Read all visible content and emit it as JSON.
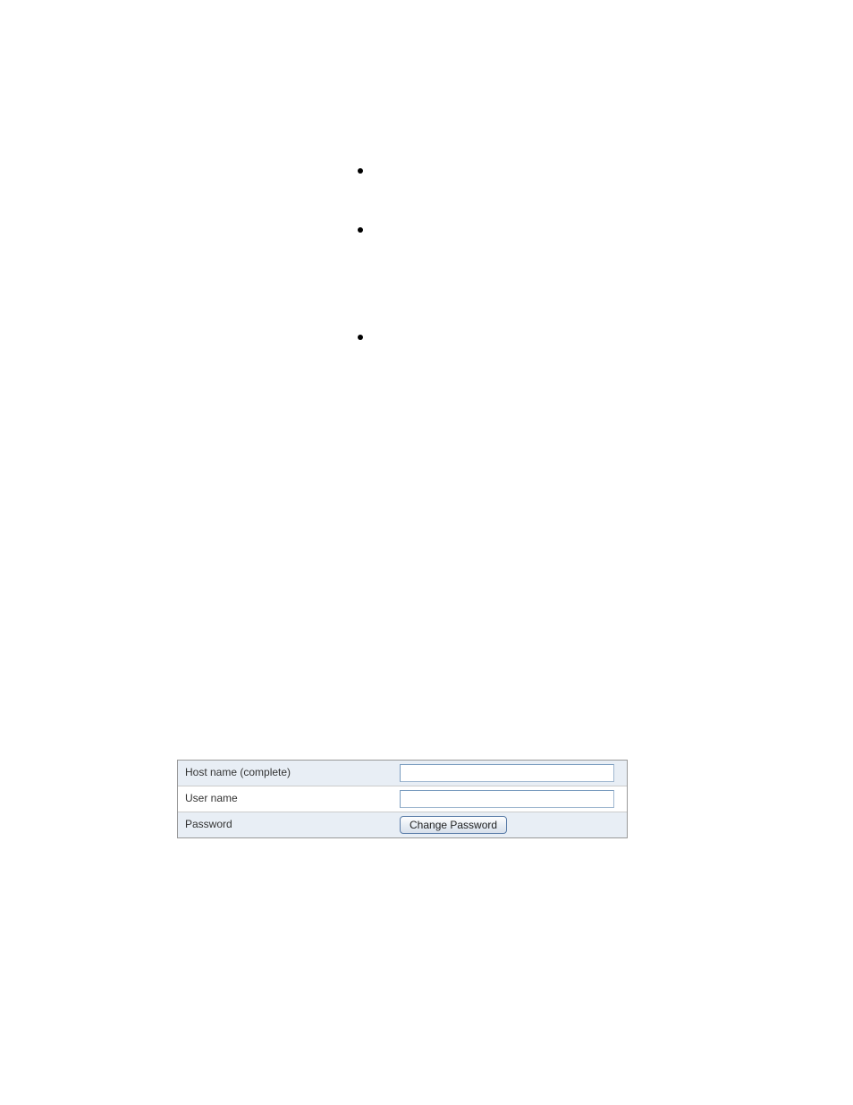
{
  "form": {
    "hostname_label": "Host name (complete)",
    "hostname_value": "",
    "username_label": "User name",
    "username_value": "",
    "password_label": "Password",
    "change_password_button": "Change Password"
  }
}
